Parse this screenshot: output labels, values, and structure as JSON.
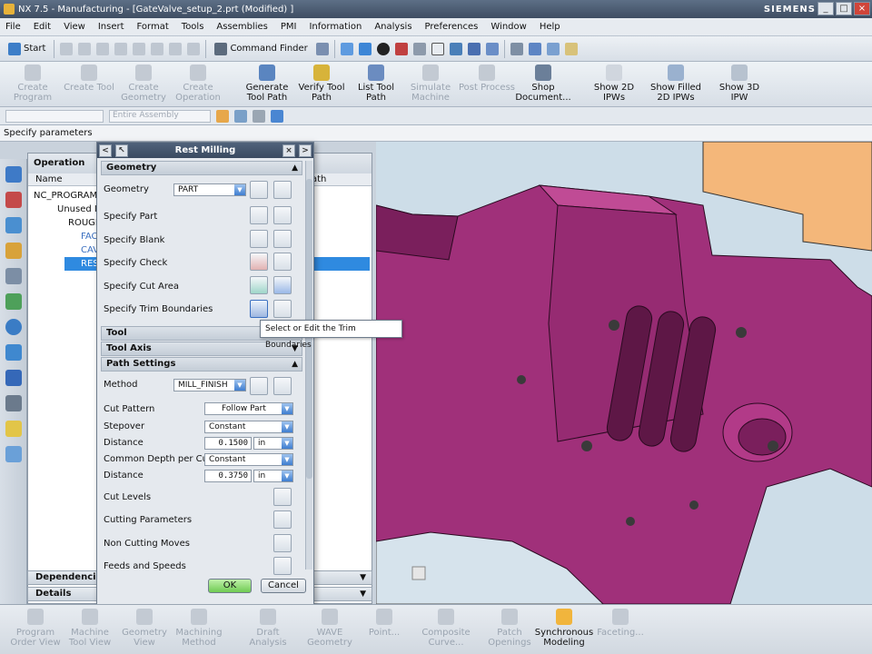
{
  "window": {
    "title": "NX 7.5 - Manufacturing - [GateValve_setup_2.prt (Modified) ]",
    "brand": "SIEMENS",
    "controls": [
      "_",
      "□",
      "×"
    ]
  },
  "menubar": [
    "File",
    "Edit",
    "View",
    "Insert",
    "Format",
    "Tools",
    "Assemblies",
    "PMI",
    "Information",
    "Analysis",
    "Preferences",
    "Window",
    "Help"
  ],
  "toolbar1": {
    "start_label": "Start",
    "command_finder_label": "Command Finder"
  },
  "ribbon": [
    {
      "label": "Create\nProgram",
      "enabled": false
    },
    {
      "label": "Create Tool",
      "enabled": false
    },
    {
      "label": "Create\nGeometry",
      "enabled": false
    },
    {
      "label": "Create\nOperation",
      "enabled": false
    },
    {
      "label": "Generate\nTool Path",
      "enabled": true
    },
    {
      "label": "Verify Tool\nPath",
      "enabled": true
    },
    {
      "label": "List Tool\nPath",
      "enabled": true
    },
    {
      "label": "Simulate\nMachine",
      "enabled": false
    },
    {
      "label": "Post Process",
      "enabled": false
    },
    {
      "label": "Shop\nDocument...",
      "enabled": true
    },
    {
      "label": "Show 2D\nIPWs",
      "enabled": true
    },
    {
      "label": "Show Filled\n2D IPWs",
      "enabled": true
    },
    {
      "label": "Show 3D IPW",
      "enabled": true
    }
  ],
  "selection_bar": {
    "filter_placeholder": "Entire Assembly"
  },
  "cue_line": "Specify parameters",
  "navigator": {
    "title": "Operation",
    "columns": {
      "name": "Name",
      "path": "ath"
    },
    "rows": [
      {
        "label": "NC_PROGRAM",
        "indent": 0,
        "selected": false
      },
      {
        "label": "Unused Ite",
        "indent": 1,
        "selected": false
      },
      {
        "label": "ROUGH",
        "indent": 1,
        "selected": false
      },
      {
        "label": "FAC",
        "indent": 2,
        "selected": false
      },
      {
        "label": "CAV",
        "indent": 2,
        "selected": false
      },
      {
        "label": "RES",
        "indent": 2,
        "selected": true
      }
    ],
    "footer": [
      {
        "label": "Dependencies"
      },
      {
        "label": "Details"
      }
    ]
  },
  "dialog": {
    "title": "Rest Milling",
    "groups": {
      "geometry": "Geometry",
      "tool": "Tool",
      "tool_axis": "Tool Axis",
      "path_settings": "Path Settings"
    },
    "geometry_label": "Geometry",
    "geometry_value": "PART",
    "specify_rows": [
      "Specify Part",
      "Specify Blank",
      "Specify Check",
      "Specify Cut Area",
      "Specify Trim Boundaries"
    ],
    "method_label": "Method",
    "method_value": "MILL_FINISH",
    "cut_pattern_label": "Cut Pattern",
    "cut_pattern_value": "Follow Part",
    "stepover_label": "Stepover",
    "stepover_value": "Constant",
    "distance1_label": "Distance",
    "distance1_value": "0.1500",
    "distance1_unit": "in",
    "common_depth_label": "Common Depth per Cut",
    "common_depth_value": "Constant",
    "distance2_label": "Distance",
    "distance2_value": "0.3750",
    "distance2_unit": "in",
    "action_rows": [
      "Cut Levels",
      "Cutting Parameters",
      "Non Cutting Moves",
      "Feeds and Speeds"
    ],
    "ok_label": "OK",
    "cancel_label": "Cancel"
  },
  "tooltip": "Select or Edit the Trim Boundaries",
  "bottombar": [
    {
      "label": "Program\nOrder View",
      "active": false
    },
    {
      "label": "Machine\nTool View",
      "active": false
    },
    {
      "label": "Geometry\nView",
      "active": false
    },
    {
      "label": "Machining\nMethod",
      "active": false
    },
    {
      "label": "Draft\nAnalysis",
      "active": false
    },
    {
      "label": "WAVE\nGeometry",
      "active": false
    },
    {
      "label": "Point...",
      "active": false
    },
    {
      "label": "Composite\nCurve...",
      "active": false
    },
    {
      "label": "Patch\nOpenings",
      "active": false
    },
    {
      "label": "Synchronous\nModeling",
      "active": true
    },
    {
      "label": "Faceting...",
      "active": false
    }
  ],
  "colors": {
    "part": "#a0307a",
    "part_dark": "#6a1c50",
    "fixture": "#f4b77a",
    "viewport_bg": "#cddde8",
    "selection": "#2f8ae0"
  }
}
